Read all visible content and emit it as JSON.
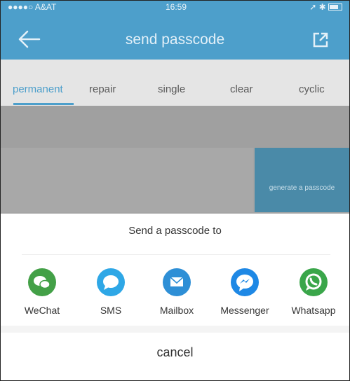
{
  "status": {
    "carrier": "●●●●○ A&AT",
    "time": "16:59"
  },
  "header": {
    "title": "send passcode"
  },
  "tabs": [
    {
      "label": "permanent",
      "active": true
    },
    {
      "label": "repair"
    },
    {
      "label": "single"
    },
    {
      "label": "clear"
    },
    {
      "label": "cyclic"
    }
  ],
  "generate_label": "generate a passcode",
  "sheet": {
    "title": "Send a passcode to",
    "options": [
      {
        "label": "WeChat",
        "icon": "wechat-icon",
        "color": "#43a047"
      },
      {
        "label": "SMS",
        "icon": "sms-icon",
        "color": "#2ea7e6"
      },
      {
        "label": "Mailbox",
        "icon": "mail-icon",
        "color": "#2e8fd6"
      },
      {
        "label": "Messenger",
        "icon": "messenger-icon",
        "color": "#1e88e5"
      },
      {
        "label": "Whatsapp",
        "icon": "whatsapp-icon",
        "color": "#3aa64a"
      }
    ],
    "cancel": "cancel"
  },
  "colors": {
    "accent": "#4d9fcb"
  }
}
